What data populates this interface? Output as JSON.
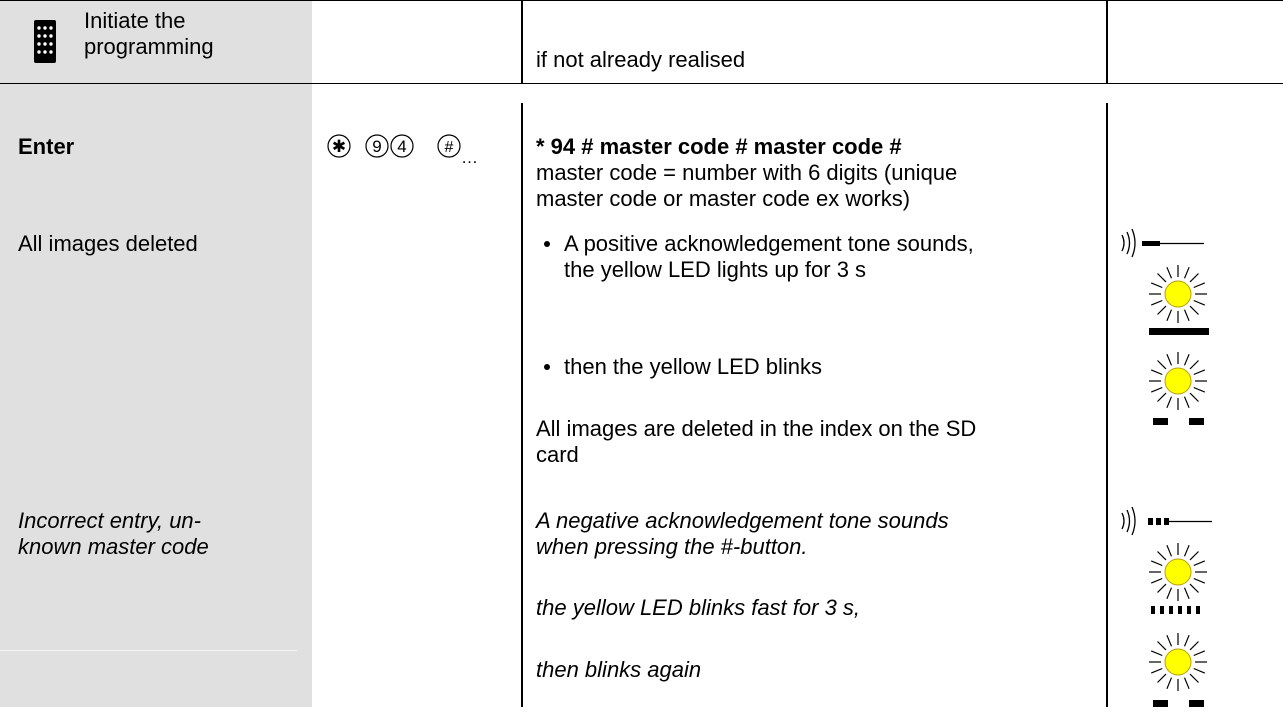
{
  "row_header": {
    "label_line1": "Initiate the",
    "label_line2": "programming",
    "note": "if not already realised"
  },
  "enter_row": {
    "label": "Enter",
    "key_sequence": [
      "✱",
      "9",
      "4",
      "#"
    ],
    "ellipsis": "…",
    "command": "* 94 # master code # master code #",
    "desc_line1": "master code = number with 6 digits (unique",
    "desc_line2": "master code or master code ex works)"
  },
  "deleted_row": {
    "label": "All images deleted",
    "bullet1_line1": "A positive acknowledgement tone sounds,",
    "bullet1_line2": "the yellow LED lights up for 3 s",
    "bullet2": "then the yellow LED blinks",
    "result_line1": "All images are deleted in the index on the SD",
    "result_line2": "card"
  },
  "incorrect_row": {
    "label_line1": "Incorrect entry, un-",
    "label_line2": "known master code",
    "tone_line1": "A negative acknowledgement tone sounds",
    "tone_line2": "when pressing the #-button.",
    "blink_fast": "the yellow LED blinks fast for 3 s,",
    "blink_again": "then blinks again"
  },
  "icons": {
    "keypad": "keypad-icon",
    "tone_positive": "positive-tone-icon",
    "tone_negative": "negative-tone-icon",
    "led": "yellow-led-icon",
    "led_color": "#ffff00",
    "led_outline": "#b8a000"
  }
}
